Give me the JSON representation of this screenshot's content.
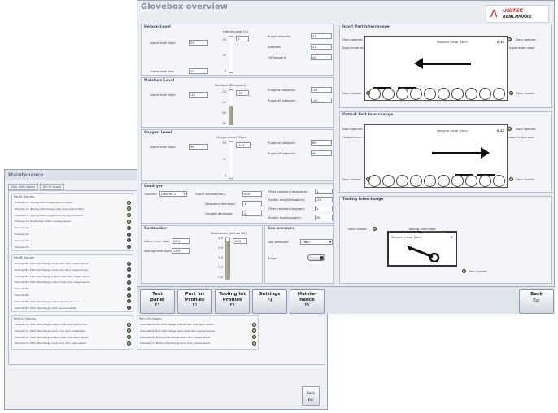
{
  "maintenance": {
    "title": "Maintenance",
    "tabs": [
      "DAS 1000 Board",
      "DIO IR Board"
    ],
    "groups": [
      {
        "title": "Port A (Inputs)",
        "lines": [
          {
            "label": "Channel A0: Tooling interchange vacuum sensor",
            "led": "on"
          },
          {
            "label": "Channel A1: Tooling interchange outer Door push-button",
            "led": "on"
          },
          {
            "label": "Channel A2: Tooling interchange inner door push-button",
            "led": "on"
          },
          {
            "label": "Channel A3: Soutsucker motor running sensor",
            "led": "on"
          },
          {
            "label": "Channel A4: -",
            "led": "off"
          },
          {
            "label": "Channel A5: -",
            "led": "off"
          },
          {
            "label": "Channel A6: -",
            "led": "off"
          },
          {
            "label": "Channel A7: -",
            "led": "off"
          }
        ]
      },
      {
        "title": "Port B (Inputs)",
        "lines": [
          {
            "label": "Channel B0: Part interchange input outer door closed sensor",
            "led": "off"
          },
          {
            "label": "Channel B1: Part interchange input inner door closed sensor",
            "led": "off"
          },
          {
            "label": "Channel B2: Part interchange output outer door closed sensor",
            "led": "off"
          },
          {
            "label": "Channel B3: Part interchange output inner door closed sensor",
            "led": "off"
          },
          {
            "label": "Channel B4: -",
            "led": "off"
          },
          {
            "label": "Channel B5: -",
            "led": "off"
          },
          {
            "label": "Channel B6: Part interchange output vacuum sensor",
            "led": "off"
          },
          {
            "label": "Channel B7: Part interchange input vacuum sensor",
            "led": "off"
          }
        ]
      },
      {
        "title": "Port CL (Inputs)",
        "lines": [
          {
            "label": "Channel C0: Part interchange output inner door pushbutton",
            "led": "on"
          },
          {
            "label": "Channel C1: Part interchange input inner door pushbutton",
            "led": "on"
          },
          {
            "label": "Channel C2: Part interchange output inner door open sensor",
            "led": "on"
          },
          {
            "label": "Channel C3: Part interchange input inner door open sensor",
            "led": "on"
          }
        ]
      },
      {
        "title": "Port CH (Inputs)",
        "lines": [
          {
            "label": "Channel C4: Part interchange output outer door open sensor",
            "led": "on"
          },
          {
            "label": "Channel C5: Part interchange input outer door opened sensor",
            "led": "on"
          },
          {
            "label": "Channel C6: Tooling interchange outer door closed sensor",
            "led": "on"
          },
          {
            "label": "Channel C7: Tooling interchange inner door closed sensor",
            "led": "on"
          }
        ]
      }
    ],
    "back_label": "Back",
    "back_key": "Esc"
  },
  "glovebox": {
    "title": "Glovebox overview",
    "logo_line1": "UNITEK",
    "logo_line2": "BENCHMARK",
    "helium": {
      "title": "Helium Level",
      "alarm_high_label": "Alarm level high:",
      "alarm_high": "25",
      "alarm_low_label": "Alarm level low:",
      "alarm_low": "19",
      "gauge_label": "HeliumLevel (%)",
      "gauge_value": "0",
      "gauge_ticks": [
        "50",
        "25",
        "0"
      ],
      "purge_setpoint_label": "Purge setpoint:",
      "purge_setpoint": "22",
      "setpoint_label": "Setpoint:",
      "setpoint": "21",
      "fill_setpoint_label": "Fill Setpoint:",
      "fill_setpoint": "20",
      "fill": 0.0
    },
    "moisture": {
      "title": "Moisture Level",
      "alarm_high_label": "Alarm level high:",
      "alarm_high": "-42",
      "gauge_label": "Moisture (Dewpoint)",
      "gauge_value": "-45",
      "gauge_ticks": [
        "-20",
        "-40",
        "-60",
        "-80"
      ],
      "purge_on_label": "Purge on setpoint:",
      "purge_on": "-45",
      "purge_off_label": "Purge off setpoint:",
      "purge_off": "-52",
      "fill": 0.55
    },
    "oxygen": {
      "title": "Oxygen Level",
      "alarm_high_label": "Alarm level high:",
      "alarm_high": "50",
      "gauge_label": "OxygenLevel (Ppm)",
      "gauge_value": "-444",
      "gauge_ticks": [
        "50",
        "25",
        "0"
      ],
      "purge_on_label": "Purge on setpoint:",
      "purge_on": "60",
      "purge_off_label": "Purge off setpoint:",
      "purge_off": "40",
      "fill": 0.0
    },
    "gasdryer": {
      "title": "Gasdryer",
      "column_label": "Column:",
      "column_value": "Column 1",
      "check_period_label": "Check periode(sec):",
      "check_period": "900",
      "dewpoint_dec_label": "Dewpoint decrease:",
      "dewpoint_dec": "1",
      "oxygen_dec_label": "Oxygen decrease:",
      "oxygen_dec": "2",
      "filter_dew_label": "Filter constant(dewpoint):",
      "filter_dew": "1",
      "switch_dew_label": "Switch level(Dewpoint):",
      "switch_dew": "-45",
      "filter_oxy_label": "Filter constant(oxygen):",
      "filter_oxy": "1",
      "switch_oxy_label": "Switch level(oxygen):",
      "switch_oxy": "30"
    },
    "soutsucker": {
      "title": "Soutsucker",
      "alarm_high_label": "Alarm level high:",
      "alarm_high": "20.0",
      "warning_high_label": "Warnig level high:",
      "warning_high": "15.0",
      "gauge_label": "Soutsucker (inches WC)",
      "gauge_value": "14.3",
      "gauge_ticks": [
        "8.0",
        "6.0",
        "4.0",
        "2.0",
        "0.0"
      ],
      "fill": 0.9
    },
    "gas_pressure": {
      "title": "Gas pressure",
      "pressure_label": "Gas pressure:",
      "pressure_value": "High",
      "purge_label": "Purge"
    },
    "input_interchange": {
      "title": "Input Part Interchange",
      "door_opened_left": "Door opened",
      "door_opened_right": "Door opened",
      "inner_door": "Input inner door",
      "outer_door": "Input outer door",
      "vacuum_label": "Vacuum Level (torr):",
      "vacuum_value": "0.13",
      "door_closed_left": "Door closed",
      "door_closed_right": "Door closed"
    },
    "output_interchange": {
      "title": "Output Part Interchange",
      "door_opened_left": "Door opened",
      "door_opened_right": "Door opened",
      "inner_door": "Output inner door",
      "outer_door": "Output outer door",
      "vacuum_label": "Vacuum Level (torr):",
      "vacuum_value": "0.21",
      "door_closed_left": "Door closed",
      "door_closed_right": "Door closed"
    },
    "tooling_interchange": {
      "title": "Tooling Interchange",
      "door_closed_left": "Door closed",
      "inner_door": "Tooling inner door",
      "vacuum_label": "Vacuum Level (torr):",
      "vacuum_value": "0",
      "door_closed_bottom": "Door closed"
    },
    "buttons": [
      {
        "line1": "Test",
        "line2": "panel",
        "key": "F1"
      },
      {
        "line1": "Part Int",
        "line2": "Profiles",
        "key": "F2"
      },
      {
        "line1": "Tooling Int",
        "line2": "Profiles",
        "key": "F3"
      },
      {
        "line1": "Settings",
        "line2": "",
        "key": "F4"
      },
      {
        "line1": "Mainte-",
        "line2": "nance",
        "key": "F5"
      }
    ],
    "back_label": "Back",
    "back_key": "Esc"
  }
}
